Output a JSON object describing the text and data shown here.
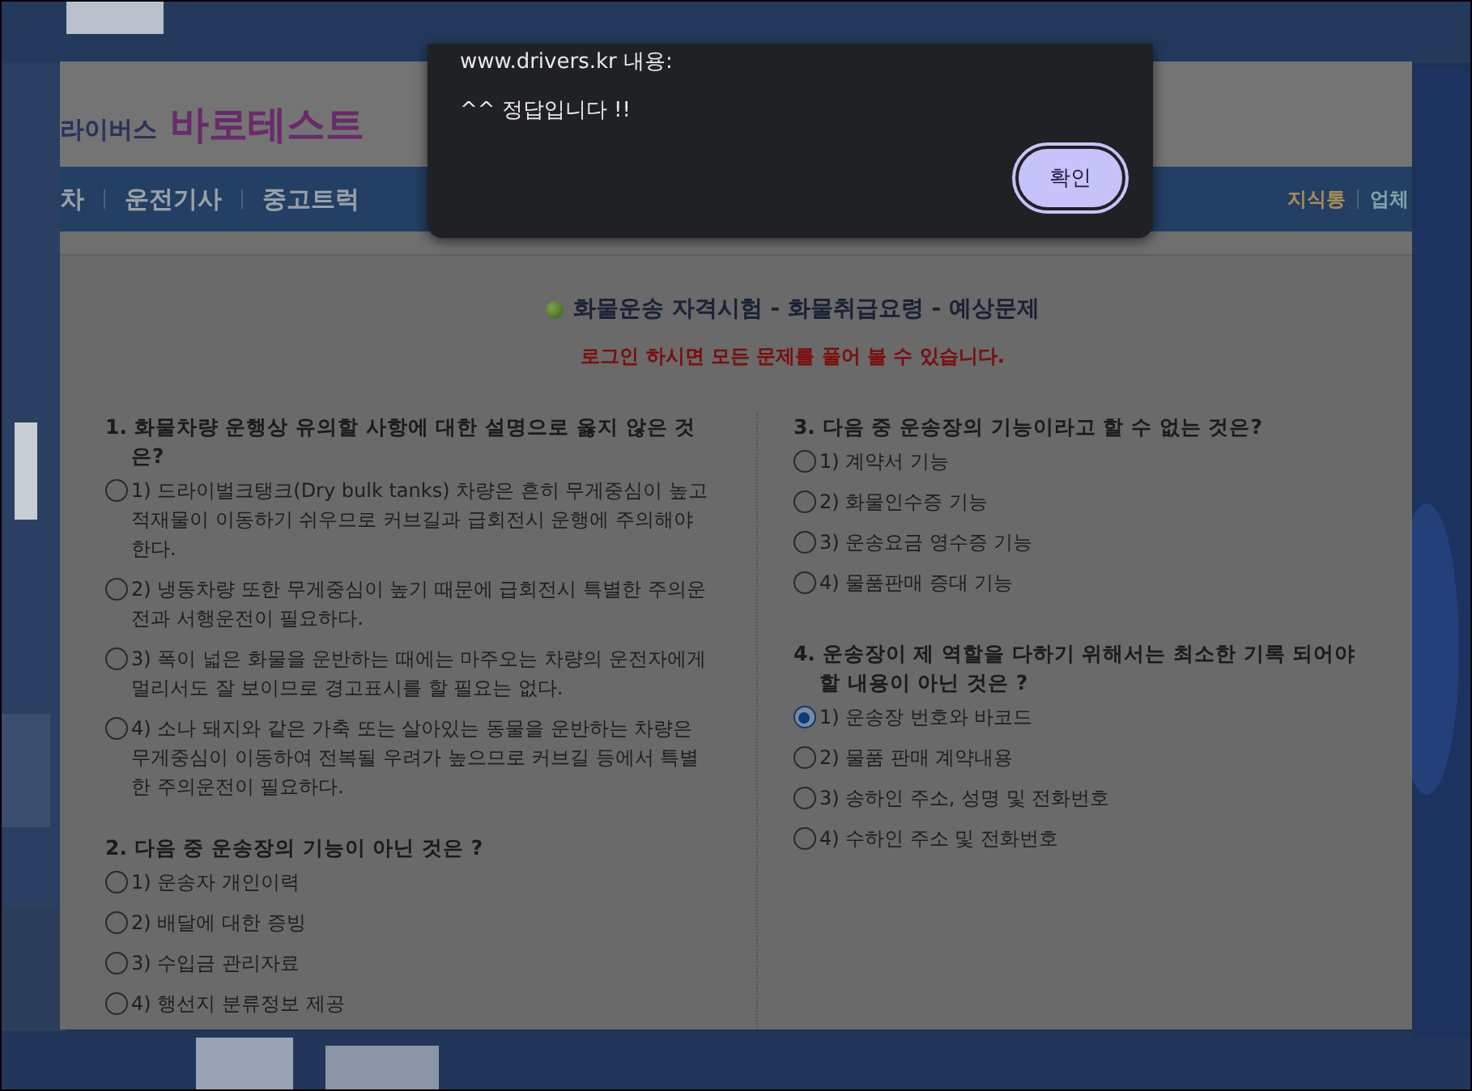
{
  "site": {
    "logo_prefix": "라이버스",
    "logo_name": "바로테스트",
    "nav": [
      {
        "label": "차"
      },
      {
        "label": "운전기사"
      },
      {
        "label": "중고트럭"
      }
    ],
    "nav_right": [
      "지식통",
      "업체"
    ]
  },
  "exam": {
    "title": "화물운송 자격시험 - 화물취급요령 - 예상문제",
    "notice": "로그인 하시면 모든 문제를 풀어 볼 수 있습니다.",
    "columns": [
      [
        {
          "question": "1. 화물차량 운행상 유의할 사항에 대한 설명으로 옳지 않은 것은?",
          "options": [
            {
              "label": "1) 드라이벌크탱크(Dry bulk tanks) 차량은 흔히 무게중심이 높고 적재물이 이동하기 쉬우므로 커브길과 급회전시 운행에 주의해야 한다.",
              "selected": false
            },
            {
              "label": "2) 냉동차량 또한 무게중심이 높기 때문에 급회전시 특별한 주의운전과 서행운전이 필요하다.",
              "selected": false
            },
            {
              "label": "3) 폭이 넓은 화물을 운반하는 때에는 마주오는 차량의 운전자에게 멀리서도 잘 보이므로 경고표시를 할 필요는 없다.",
              "selected": false
            },
            {
              "label": "4) 소나 돼지와 같은 가축 또는 살아있는 동물을 운반하는 차량은 무게중심이 이동하여 전복될 우려가 높으므로 커브길 등에서 특별한 주의운전이 필요하다.",
              "selected": false
            }
          ]
        },
        {
          "question": "2. 다음 중 운송장의 기능이 아닌 것은 ?",
          "options": [
            {
              "label": "1) 운송자 개인이력",
              "selected": false
            },
            {
              "label": "2) 배달에 대한 증빙",
              "selected": false
            },
            {
              "label": "3) 수입금 관리자료",
              "selected": false
            },
            {
              "label": "4) 행선지 분류정보 제공",
              "selected": false
            }
          ]
        }
      ],
      [
        {
          "question": "3. 다음 중 운송장의 기능이라고 할 수 없는 것은?",
          "options": [
            {
              "label": "1) 계약서 기능",
              "selected": false
            },
            {
              "label": "2) 화물인수증 기능",
              "selected": false
            },
            {
              "label": "3) 운송요금 영수증 기능",
              "selected": false
            },
            {
              "label": "4) 물품판매 증대 기능",
              "selected": false
            }
          ]
        },
        {
          "question": "4. 운송장이 제 역할을 다하기 위해서는 최소한 기록 되어야 할 내용이 아닌 것은 ?",
          "options": [
            {
              "label": "1) 운송장 번호와 바코드",
              "selected": true
            },
            {
              "label": "2) 물품 판매 계약내용",
              "selected": false
            },
            {
              "label": "3) 송하인 주소, 성명 및 전화번호",
              "selected": false
            },
            {
              "label": "4) 수하인 주소 및 전화번호",
              "selected": false
            }
          ]
        }
      ]
    ]
  },
  "dialog": {
    "origin": "www.drivers.kr 내용:",
    "message": "^^ 정답입니다 !!",
    "button": "확인"
  }
}
